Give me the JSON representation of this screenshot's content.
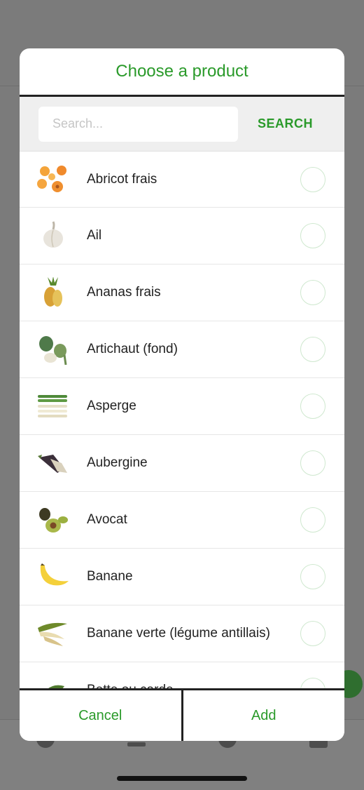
{
  "modal": {
    "title": "Choose a product",
    "search": {
      "placeholder": "Search...",
      "value": "",
      "button_label": "SEARCH"
    },
    "products": [
      {
        "label": "Abricot frais",
        "icon": "apricot-icon",
        "selected": false
      },
      {
        "label": "Ail",
        "icon": "garlic-icon",
        "selected": false
      },
      {
        "label": "Ananas frais",
        "icon": "pineapple-icon",
        "selected": false
      },
      {
        "label": "Artichaut (fond)",
        "icon": "artichoke-icon",
        "selected": false
      },
      {
        "label": "Asperge",
        "icon": "asparagus-icon",
        "selected": false
      },
      {
        "label": "Aubergine",
        "icon": "eggplant-icon",
        "selected": false
      },
      {
        "label": "Avocat",
        "icon": "avocado-icon",
        "selected": false
      },
      {
        "label": "Banane",
        "icon": "banana-icon",
        "selected": false
      },
      {
        "label": "Banane verte (légume antillais)",
        "icon": "green-banana-icon",
        "selected": false
      },
      {
        "label": "Bette ou carde",
        "icon": "chard-icon",
        "selected": false
      }
    ],
    "footer": {
      "cancel_label": "Cancel",
      "add_label": "Add"
    }
  },
  "colors": {
    "accent": "#2a9a2a",
    "overlay": "#7b7b7b",
    "radio_border": "#cfe8cf"
  }
}
